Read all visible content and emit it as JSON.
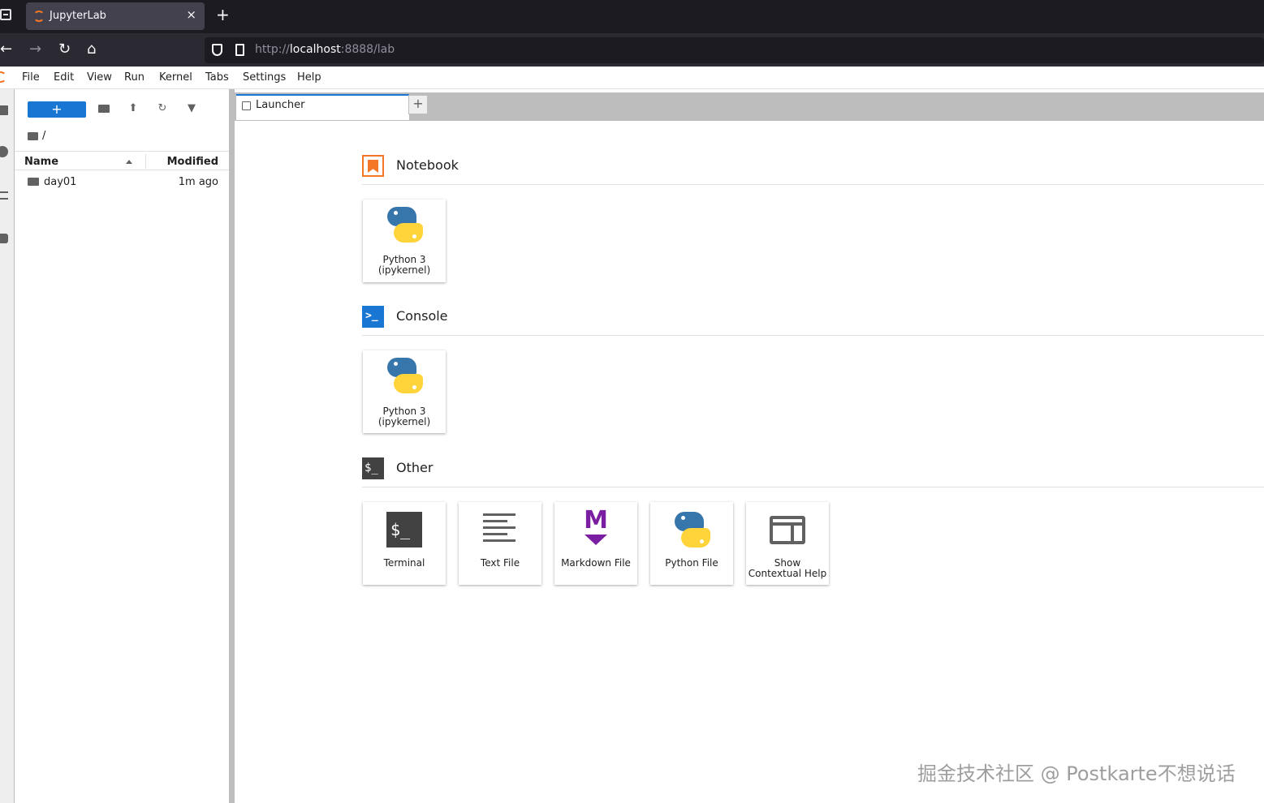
{
  "browser": {
    "tab_title": "JupyterLab",
    "tab_close": "×",
    "new_tab": "+",
    "url_scheme": "http://",
    "url_host": "localhost",
    "url_rest": ":8888/lab"
  },
  "menu": [
    "File",
    "Edit",
    "View",
    "Run",
    "Kernel",
    "Tabs",
    "Settings",
    "Help"
  ],
  "filebrowser": {
    "new_button": "+",
    "breadcrumb": "/",
    "col_name": "Name",
    "col_modified": "Modified",
    "rows": [
      {
        "name": "day01",
        "modified": "1m ago"
      }
    ]
  },
  "dock": {
    "tab_title": "Launcher",
    "add_tab": "+"
  },
  "launcher": {
    "notebook": {
      "title": "Notebook",
      "cards": [
        {
          "line1": "Python 3",
          "line2": "(ipykernel)"
        }
      ]
    },
    "console": {
      "title": "Console",
      "icon_text": ">_",
      "cards": [
        {
          "line1": "Python 3",
          "line2": "(ipykernel)"
        }
      ]
    },
    "other": {
      "title": "Other",
      "icon_text": "$_",
      "cards": [
        {
          "label": "Terminal",
          "icon_text": "$_"
        },
        {
          "label": "Text File"
        },
        {
          "label": "Markdown File",
          "icon_text": "M"
        },
        {
          "label": "Python File"
        },
        {
          "line1": "Show",
          "line2": "Contextual Help"
        }
      ]
    }
  },
  "watermark": "掘金技术社区 @ Postkarte不想说话",
  "colors": {
    "accent": "#1976d2",
    "jupyter_orange": "#f37726",
    "markdown_purple": "#7b1fa2"
  }
}
